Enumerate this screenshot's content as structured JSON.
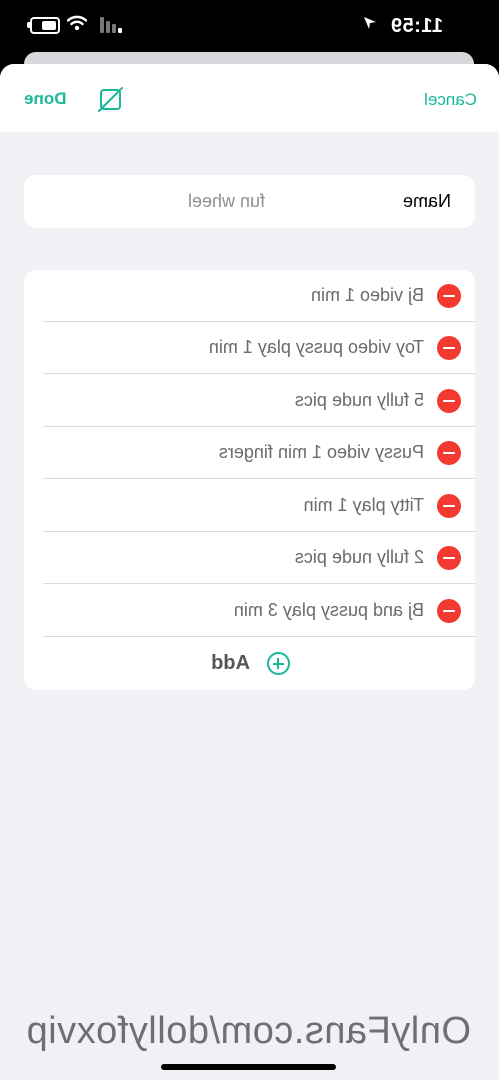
{
  "status_bar": {
    "time": "11:59",
    "icons": [
      "location-arrow-icon",
      "cellular-signal-icon",
      "wifi-icon",
      "battery-icon"
    ]
  },
  "nav": {
    "cancel_label": "Cancel",
    "done_label": "Done",
    "icon": "edit-square-icon"
  },
  "name_field": {
    "label": "Name",
    "value": "fun wheel"
  },
  "items": [
    "Bj video 1 min",
    "Toy video pussy play 1 min",
    "5 fully nude pics",
    "Pussy video 1 min fingers",
    "Titty play 1 min",
    "2  fully nude pics",
    "Bj and pussy play 3 min"
  ],
  "add_label": "Add",
  "watermark": "OnlyFans.com/dollyfoxvip",
  "colors": {
    "accent": "#18b898",
    "delete": "#f23a30",
    "background": "#f1f1f5"
  }
}
